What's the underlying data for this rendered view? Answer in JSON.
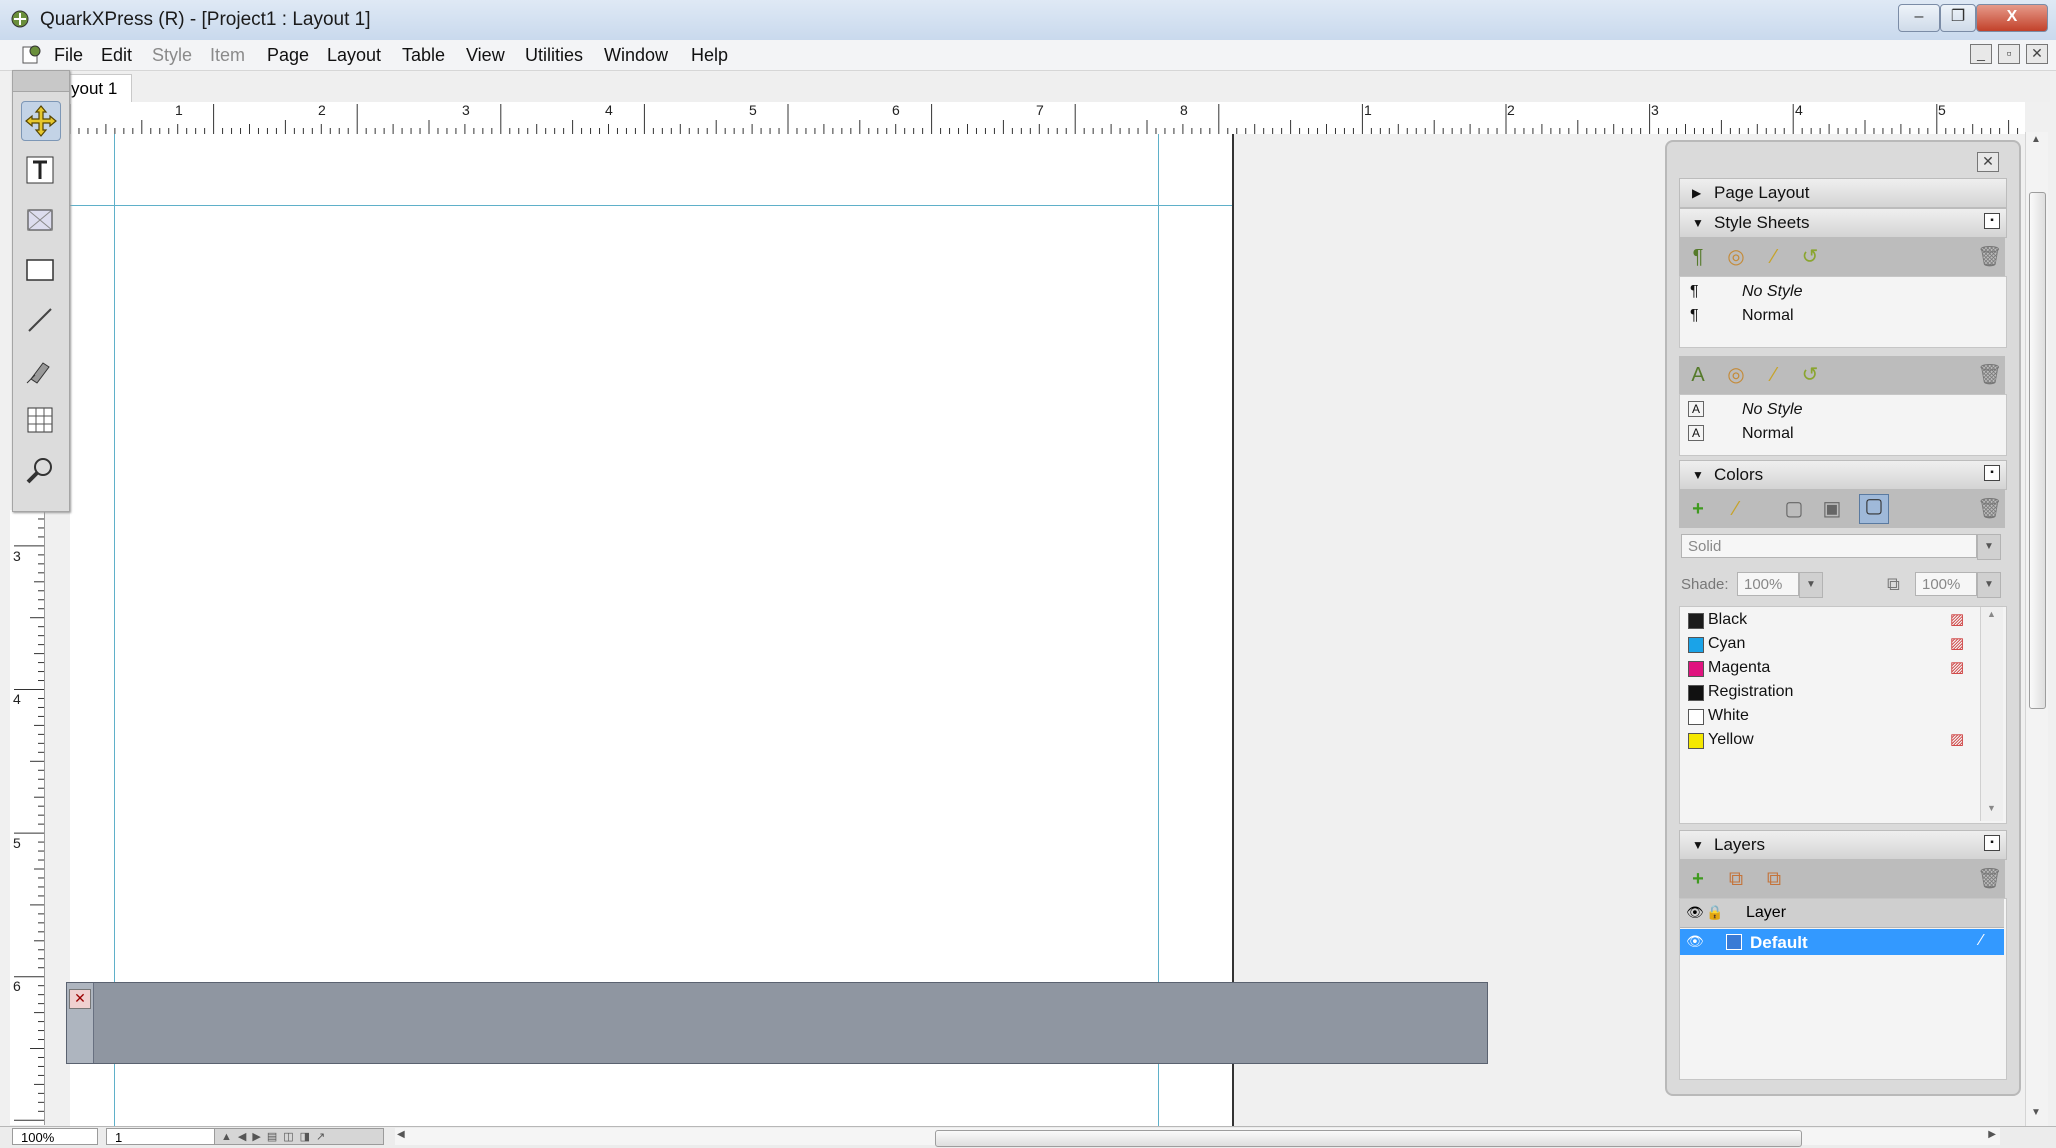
{
  "window": {
    "title": "QuarkXPress (R) - [Project1 : Layout 1]",
    "controls": {
      "minimize": "–",
      "restore": "❐",
      "close": "X"
    }
  },
  "menubar": {
    "items": [
      {
        "label": "File",
        "enabled": true
      },
      {
        "label": "Edit",
        "enabled": true
      },
      {
        "label": "Style",
        "enabled": false
      },
      {
        "label": "Item",
        "enabled": false
      },
      {
        "label": "Page",
        "enabled": true
      },
      {
        "label": "Layout",
        "enabled": true
      },
      {
        "label": "Table",
        "enabled": true
      },
      {
        "label": "View",
        "enabled": true
      },
      {
        "label": "Utilities",
        "enabled": true
      },
      {
        "label": "Window",
        "enabled": true
      },
      {
        "label": "Help",
        "enabled": true
      }
    ],
    "doc_controls": {
      "minimize": "_",
      "restore": "▫",
      "close": "✕"
    }
  },
  "document": {
    "tab_label": "yout 1",
    "tab_close": "✕"
  },
  "rulers": {
    "horizontal_labels_page1": [
      "1",
      "2",
      "3",
      "4",
      "5",
      "6",
      "7",
      "8"
    ],
    "horizontal_labels_page2": [
      "1",
      "2",
      "3",
      "4",
      "5"
    ],
    "vertical_labels": [
      "3",
      "4",
      "5",
      "6"
    ]
  },
  "toolbox": {
    "tools": [
      "item-tool-icon",
      "text-content-tool-icon",
      "picture-content-tool-icon",
      "rectangle-box-tool-icon",
      "line-tool-icon",
      "pen-tool-icon",
      "table-tool-icon",
      "zoom-tool-icon"
    ]
  },
  "palette": {
    "close": "✕",
    "sections": {
      "page_layout": {
        "title": "Page Layout",
        "expanded": false
      },
      "style_sheets": {
        "title": "Style Sheets",
        "expanded": true,
        "paragraph_styles": [
          {
            "name": "No Style",
            "italic": true,
            "icon": "¶"
          },
          {
            "name": "Normal",
            "italic": false,
            "icon": "¶"
          }
        ],
        "character_styles": [
          {
            "name": "No Style",
            "italic": true,
            "icon": "A"
          },
          {
            "name": "Normal",
            "italic": false,
            "icon": "A"
          }
        ]
      },
      "colors": {
        "title": "Colors",
        "expanded": true,
        "type_value": "Solid",
        "shade_label": "Shade:",
        "shade_value": "100%",
        "opacity_value": "100%",
        "items": [
          {
            "name": "Black",
            "swatch": "#1a1a1a",
            "process_icon": true
          },
          {
            "name": "Cyan",
            "swatch": "#1aa3e8",
            "process_icon": true
          },
          {
            "name": "Magenta",
            "swatch": "#e0137f",
            "process_icon": true
          },
          {
            "name": "Registration",
            "swatch": "#111111",
            "process_icon": false
          },
          {
            "name": "White",
            "swatch": "#ffffff",
            "process_icon": false
          },
          {
            "name": "Yellow",
            "swatch": "#f5e800",
            "process_icon": true
          }
        ]
      },
      "layers": {
        "title": "Layers",
        "expanded": true,
        "header_label": "Layer",
        "items": [
          {
            "name": "Default",
            "selected": true,
            "color": "#3a7bd5"
          }
        ]
      }
    }
  },
  "statusbar": {
    "zoom": "100%",
    "page": "1"
  },
  "colors": {
    "guide": "#5fb0c9",
    "layer_selected_bg": "#3399ff",
    "pasteboard_strip": "#8f96a1"
  }
}
